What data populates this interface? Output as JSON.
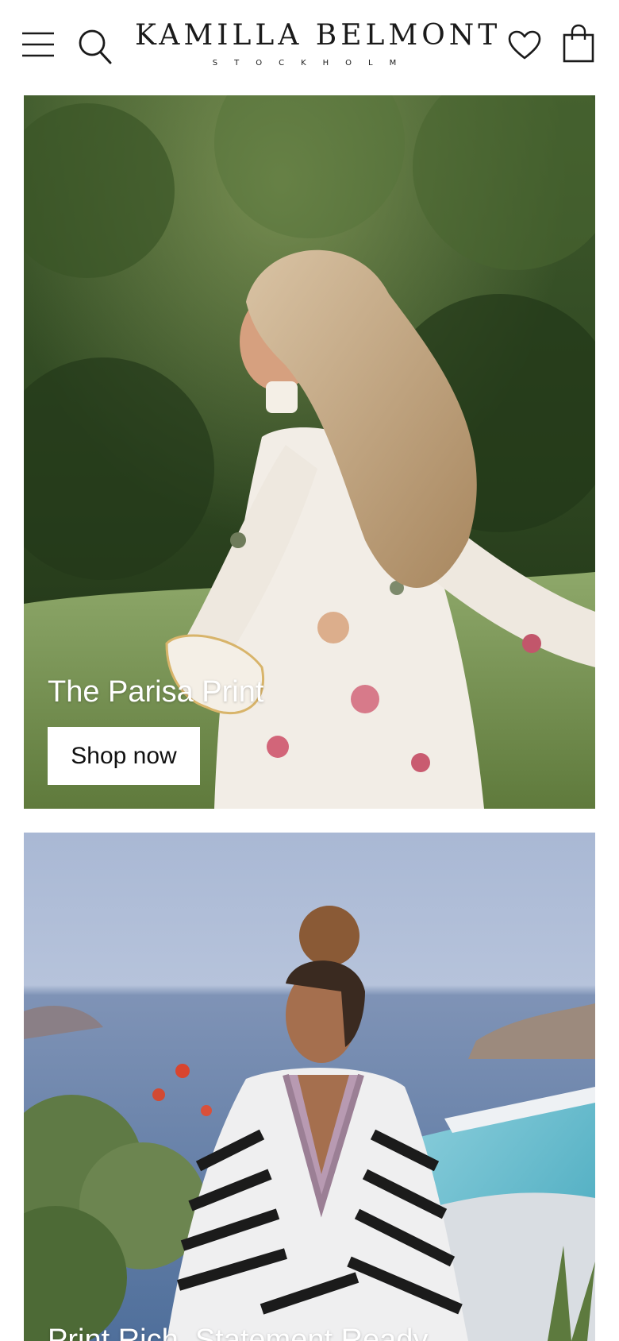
{
  "header": {
    "brand_name": "KAMILLA BELMONT",
    "brand_subtitle": "STOCKHOLM",
    "icons": {
      "menu": "hamburger-menu-icon",
      "search": "search-icon",
      "wishlist": "heart-icon",
      "cart": "shopping-bag-icon"
    }
  },
  "banners": [
    {
      "title": "The Parisa Print",
      "cta_label": "Shop now",
      "image": "woman-in-floral-print-dress-running-through-meadow"
    },
    {
      "title": "Print Rich, Statement Ready",
      "image": "woman-in-zebra-stripe-kaftan-by-sea-and-pool"
    }
  ],
  "colors": {
    "background": "#ffffff",
    "text_dark": "#1a1a1a",
    "overlay_text": "#ffffff",
    "button_bg": "#ffffff"
  }
}
